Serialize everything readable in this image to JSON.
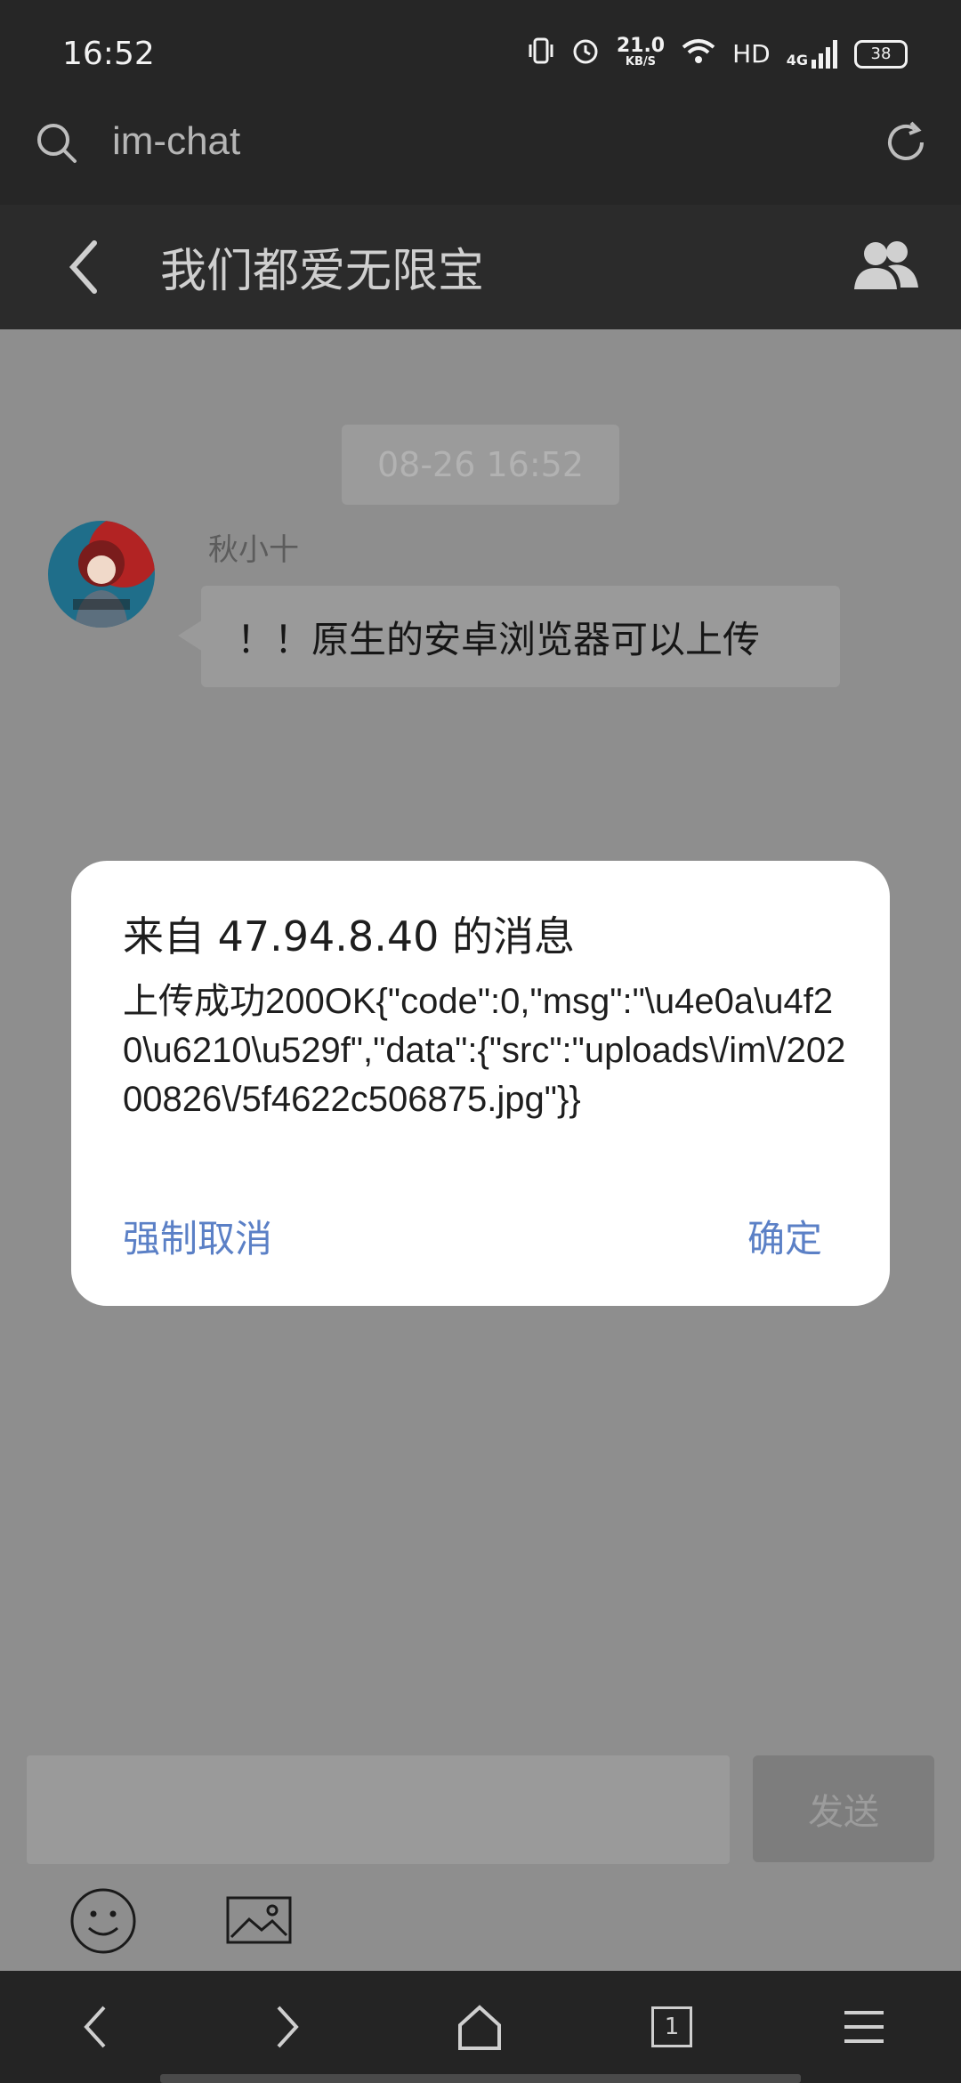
{
  "status_bar": {
    "time": "16:52",
    "network_speed": "21.0",
    "network_speed_unit": "KB/S",
    "hd_label": "HD",
    "signal_label": "4G",
    "battery": "38"
  },
  "browser": {
    "url": "im-chat"
  },
  "chat": {
    "title": "我们都爱无限宝",
    "timestamp": "08-26 16:52",
    "messages": [
      {
        "sender": "秋小十",
        "text": "！！原生的安卓浏览器可以上传"
      }
    ]
  },
  "dialog": {
    "title": "来自 47.94.8.40 的消息",
    "message": "上传成功200OK{\"code\":0,\"msg\":\"\\u4e0a\\u4f20\\u6210\\u529f\",\"data\":{\"src\":\"uploads\\/im\\/20200826\\/5f4622c506875.jpg\"}}",
    "cancel_label": "强制取消",
    "ok_label": "确定"
  },
  "input": {
    "placeholder": "",
    "send_label": "发送"
  },
  "nav": {
    "tab_count": "1"
  },
  "colors": {
    "dialog_button": "#5b80c6",
    "overlay": "#8e8e8e",
    "bar_dark": "#262626"
  }
}
